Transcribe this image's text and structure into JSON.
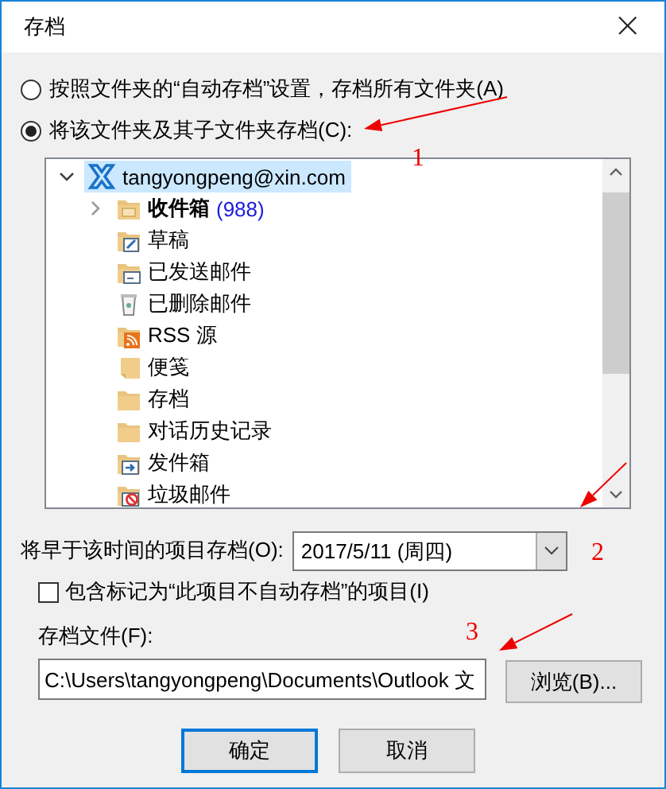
{
  "window": {
    "title": "存档",
    "close": "×"
  },
  "options": [
    {
      "label": "按照文件夹的“自动存档”设置，存档所有文件夹(A)",
      "selected": false
    },
    {
      "label": "将该文件夹及其子文件夹存档(C):",
      "selected": true
    }
  ],
  "tree": {
    "items": [
      {
        "kind": "account",
        "label": "tangyongpeng@xin.com",
        "expanded": true,
        "selected": true,
        "children": [
          {
            "kind": "inbox",
            "label": "收件箱",
            "count": "(988)",
            "expanded": false,
            "bold": true
          },
          {
            "kind": "drafts",
            "label": "草稿"
          },
          {
            "kind": "sent",
            "label": "已发送邮件"
          },
          {
            "kind": "deleted",
            "label": "已删除邮件"
          },
          {
            "kind": "rss",
            "label": "RSS 源"
          },
          {
            "kind": "notes",
            "label": "便笺"
          },
          {
            "kind": "folder",
            "label": "存档"
          },
          {
            "kind": "folder",
            "label": "对话历史记录"
          },
          {
            "kind": "outbox",
            "label": "发件箱"
          },
          {
            "kind": "junk",
            "label": "垃圾邮件"
          }
        ]
      }
    ]
  },
  "date": {
    "label": "将早于该时间的项目存档(O):",
    "value": "2017/5/11 (周四)"
  },
  "include_flagged": {
    "label": "包含标记为“此项目不自动存档”的项目(I)",
    "checked": false
  },
  "archive_file": {
    "label": "存档文件(F):",
    "value": "C:\\Users\\tangyongpeng\\Documents\\Outlook 文",
    "browse": "浏览(B)..."
  },
  "buttons": [
    {
      "label": "确定",
      "default": true
    },
    {
      "label": "取消",
      "default": false
    }
  ],
  "annotations": [
    {
      "text": "1"
    },
    {
      "text": "2"
    },
    {
      "text": "3"
    }
  ]
}
